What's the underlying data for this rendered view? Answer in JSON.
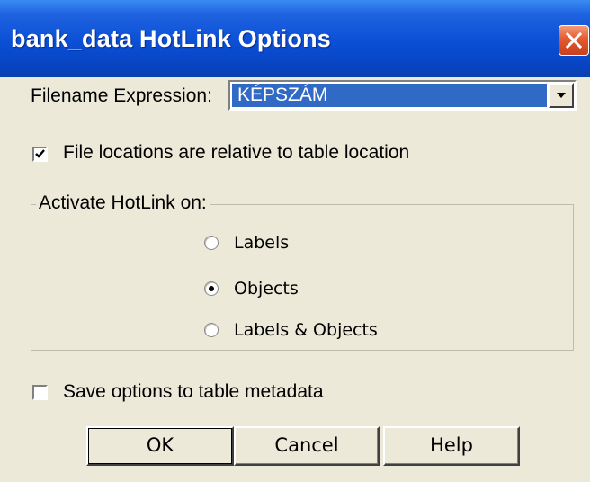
{
  "window": {
    "title": "bank_data HotLink Options",
    "close_icon": "close-icon"
  },
  "filename": {
    "label": "Filename Expression:",
    "value": "KÉPSZÁM",
    "dropdown_icon": "chevron-down-icon"
  },
  "relative_option": {
    "label": "File locations are relative to table location",
    "checked": true
  },
  "activate_group": {
    "legend": "Activate HotLink on:",
    "options": [
      {
        "label": "Labels",
        "selected": false
      },
      {
        "label": "Objects",
        "selected": true
      },
      {
        "label": "Labels & Objects",
        "selected": false
      }
    ]
  },
  "save_option": {
    "label": "Save options to table metadata",
    "checked": false
  },
  "buttons": {
    "ok": "OK",
    "cancel": "Cancel",
    "help": "Help"
  },
  "colors": {
    "titlebar": "#0a4fd6",
    "selection": "#316ac5",
    "dialog_bg": "#ece9d8",
    "close_button": "#e25a30"
  }
}
